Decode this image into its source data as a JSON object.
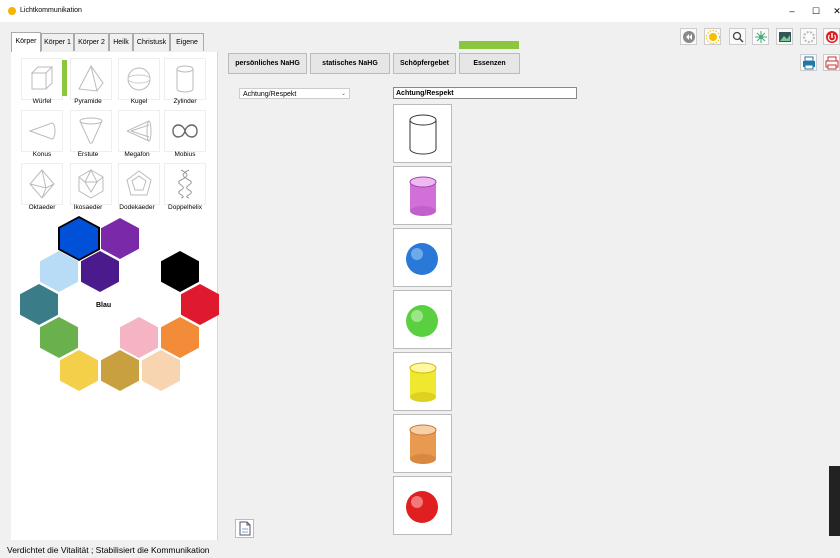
{
  "window": {
    "title": "Lichtkommunikation",
    "minimize": "–",
    "maximize": "☐",
    "close": "✕"
  },
  "tabs": [
    "Körper",
    "Körper 1",
    "Körper 2",
    "Heilk",
    "Christusk",
    "Eigene"
  ],
  "shapes": [
    {
      "label": "Würfel",
      "icon": "cube-icon"
    },
    {
      "label": "Pyramide",
      "icon": "pyramid-icon"
    },
    {
      "label": "Kugel",
      "icon": "sphere-icon"
    },
    {
      "label": "Zylinder",
      "icon": "cylinder-icon"
    },
    {
      "label": "Konus",
      "icon": "cone-icon"
    },
    {
      "label": "Erstute",
      "icon": "funnel-icon"
    },
    {
      "label": "Megafon",
      "icon": "megaphone-icon"
    },
    {
      "label": "Mobius",
      "icon": "mobius-icon"
    },
    {
      "label": "Oktaeder",
      "icon": "octahedron-icon"
    },
    {
      "label": "Ikosaeder",
      "icon": "icosahedron-icon"
    },
    {
      "label": "Dodekaeder",
      "icon": "dodecahedron-icon"
    },
    {
      "label": "Doppelhelix",
      "icon": "double-helix-icon"
    }
  ],
  "colors": {
    "selected_label": "Blau",
    "wheel": [
      "#0050d8",
      "#7a2aa8",
      "#ffffff",
      "#b8dcf5",
      "#4b1a8c",
      "#000000",
      "#3a7c88",
      "#e01a2e",
      "#6ab04c",
      "#f4b4c4",
      "#f28c38",
      "#f4d04a",
      "#c8a040",
      "#f8d4b0"
    ]
  },
  "top_buttons": [
    "persönliches NaHG",
    "statisches NaHG",
    "Schöpfergebet",
    "Essenzen"
  ],
  "dropdown": {
    "value": "Achtung/Respekt"
  },
  "name_field": {
    "value": "Achtung/Respekt"
  },
  "tiles": [
    {
      "type": "cylinder",
      "color": "#ffffff"
    },
    {
      "type": "cylinder",
      "color": "#d070d8"
    },
    {
      "type": "sphere",
      "color": "#2a78d8"
    },
    {
      "type": "sphere",
      "color": "#5ad040"
    },
    {
      "type": "cylinder",
      "color": "#f0e830"
    },
    {
      "type": "cylinder",
      "color": "#e89a50"
    },
    {
      "type": "sphere",
      "color": "#e02020"
    }
  ],
  "toolbar_icons": [
    "rewind-icon",
    "sun-icon",
    "search-icon",
    "network-icon",
    "image-icon",
    "settings-icon",
    "power-icon",
    "print-icon",
    "print-settings-icon"
  ],
  "status": {
    "text": "Verdichtet die Vitalität  ;  Stabilisiert die Kommunikation"
  }
}
